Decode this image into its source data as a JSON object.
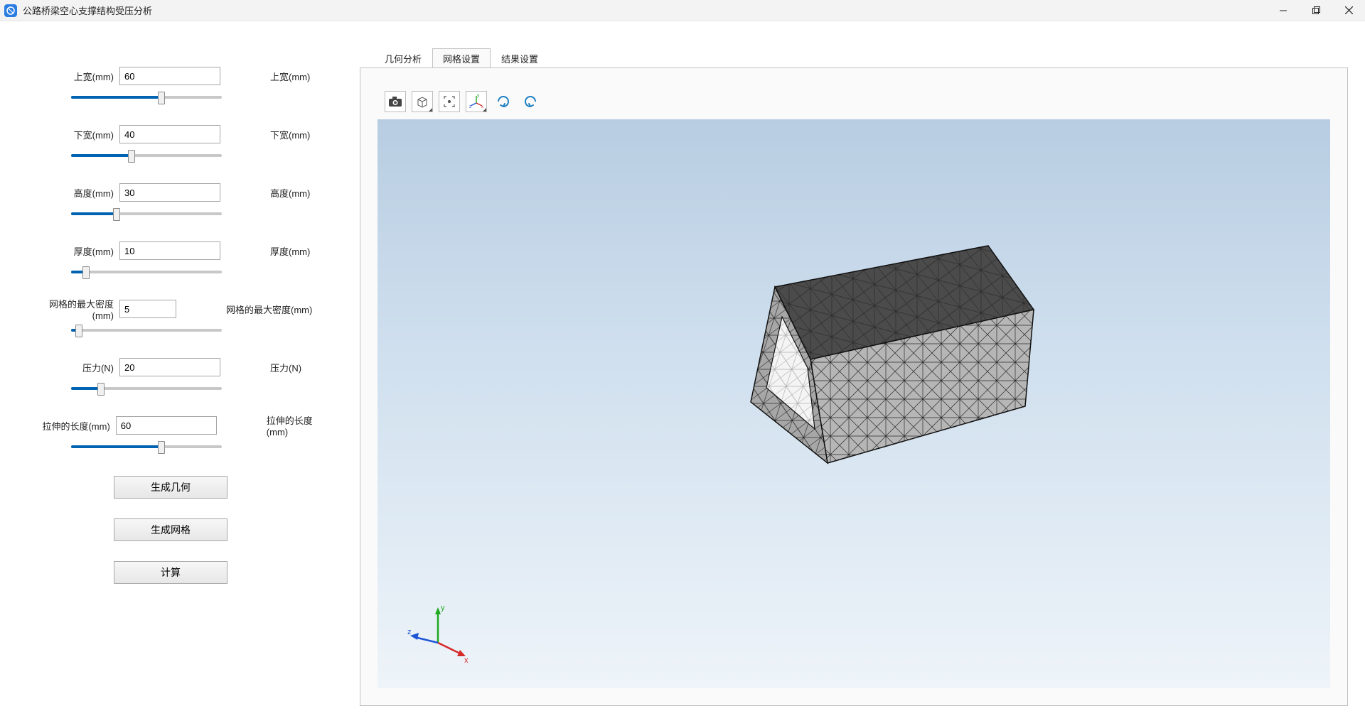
{
  "window": {
    "title": "公路桥梁空心支撑结构受压分析"
  },
  "params": [
    {
      "label": "上宽(mm)",
      "value": "60",
      "echo": "上宽(mm)",
      "fill": 60,
      "narrow": false
    },
    {
      "label": "下宽(mm)",
      "value": "40",
      "echo": "下宽(mm)",
      "fill": 40,
      "narrow": false
    },
    {
      "label": "高度(mm)",
      "value": "30",
      "echo": "高度(mm)",
      "fill": 30,
      "narrow": false
    },
    {
      "label": "厚度(mm)",
      "value": "10",
      "echo": "厚度(mm)",
      "fill": 10,
      "narrow": false
    },
    {
      "label": "网格的最大密度(mm)",
      "value": "5",
      "echo": "网格的最大密度(mm)",
      "fill": 5,
      "narrow": true
    },
    {
      "label": "压力(N)",
      "value": "20",
      "echo": "压力(N)",
      "fill": 20,
      "narrow": false
    },
    {
      "label": "拉伸的长度(mm)",
      "value": "60",
      "echo": "拉伸的长度(mm)",
      "fill": 60,
      "narrow": false
    }
  ],
  "buttons": {
    "generate_geometry": "生成几何",
    "generate_mesh": "生成网格",
    "compute": "计算"
  },
  "tabs": {
    "geometry": "几何分析",
    "mesh": "网格设置",
    "results": "结果设置",
    "active": "mesh"
  },
  "toolbar_icons": [
    "camera-icon",
    "cube-icon",
    "fit-view-icon",
    "axes-icon",
    "rotate-right-icon",
    "rotate-left-icon"
  ],
  "axes": {
    "x": "x",
    "y": "y",
    "z": "z"
  }
}
